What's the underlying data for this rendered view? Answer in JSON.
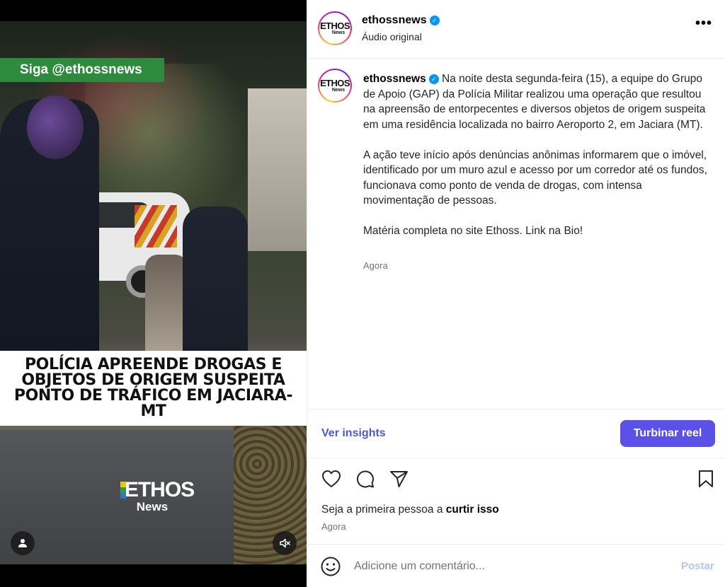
{
  "video": {
    "banner_text": "Siga @ethossnews",
    "headline": "POLÍCIA APREENDE DROGAS E OBJETOS DE ORIGEM SUSPEITA PONTO DE TRÁFICO EM JACIARA-MT",
    "watermark_big": "ETHOS",
    "watermark_small": "News",
    "user_icon": "person-icon",
    "mute_icon": "speaker-muted-icon"
  },
  "header": {
    "avatar_text_top": "ETHOS",
    "avatar_text_bottom": "News",
    "username": "ethossnews",
    "verified_mark": "✓",
    "audio_label": "Áudio original",
    "more_label": "•••"
  },
  "caption": {
    "username": "ethossnews",
    "paragraphs": [
      "Na noite desta segunda-feira (15), a equipe do Grupo de Apoio (GAP) da Polícia Militar realizou uma operação que resultou na apreensão de entorpecentes e diversos objetos de origem suspeita em uma residência localizada no bairro Aeroporto 2, em Jaciara (MT).",
      "A ação teve início após denúncias anônimas informarem que o imóvel, identificado por um muro azul e acesso por um corredor até os fundos, funcionava como ponto de venda de drogas, com intensa movimentação de pessoas.",
      "Matéria completa no site Ethoss. Link na Bio!"
    ],
    "time": "Agora"
  },
  "actions": {
    "insights_label": "Ver insights",
    "boost_label": "Turbinar reel"
  },
  "engagement": {
    "likes_prefix": "Seja a primeira pessoa a ",
    "likes_action": "curtir isso",
    "time": "Agora"
  },
  "comment": {
    "placeholder": "Adicione um comentário...",
    "post_label": "Postar"
  },
  "colors": {
    "accent": "#5b51e8",
    "link": "#4a5bd0",
    "verified": "#0095f6",
    "banner_green": "#2e8a3c"
  }
}
